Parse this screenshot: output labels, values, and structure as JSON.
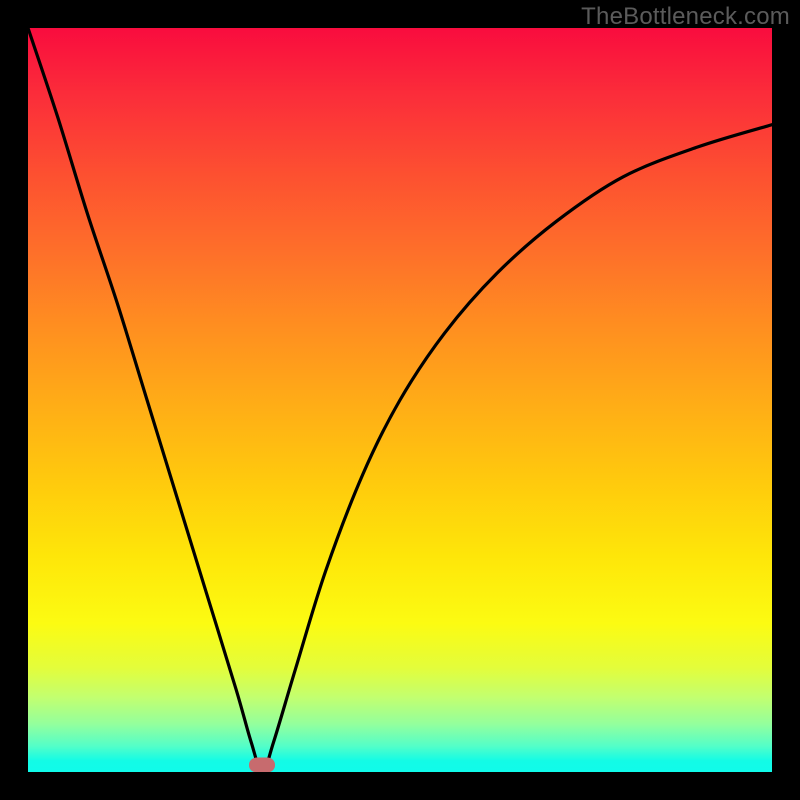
{
  "watermark": "TheBottleneck.com",
  "marker": {
    "x_pct": 31.5,
    "y_pct": 99.0
  },
  "chart_data": {
    "type": "line",
    "title": "",
    "xlabel": "",
    "ylabel": "",
    "xlim": [
      0,
      100
    ],
    "ylim": [
      0,
      100
    ],
    "grid": false,
    "legend": false,
    "annotations": [
      "TheBottleneck.com"
    ],
    "series": [
      {
        "name": "bottleneck-curve",
        "x": [
          0,
          4,
          8,
          12,
          16,
          20,
          24,
          28,
          30,
          31.5,
          33,
          36,
          40,
          45,
          50,
          56,
          63,
          71,
          80,
          90,
          100
        ],
        "values": [
          100,
          88,
          75,
          63,
          50,
          37,
          24,
          11,
          4,
          0,
          4,
          14,
          27,
          40,
          50,
          59,
          67,
          74,
          80,
          84,
          87
        ]
      }
    ],
    "background_gradient_axis": "y",
    "background_gradient": [
      {
        "stop": 0.0,
        "color": "#13fbe6"
      },
      {
        "stop": 0.05,
        "color": "#54fec8"
      },
      {
        "stop": 0.1,
        "color": "#c2ff70"
      },
      {
        "stop": 0.2,
        "color": "#fcfb12"
      },
      {
        "stop": 0.4,
        "color": "#ffca0d"
      },
      {
        "stop": 0.6,
        "color": "#ff8e20"
      },
      {
        "stop": 0.8,
        "color": "#fd5130"
      },
      {
        "stop": 1.0,
        "color": "#f90c3e"
      }
    ],
    "marker": {
      "x": 31.5,
      "y": 0,
      "color": "#c76b6e"
    }
  }
}
